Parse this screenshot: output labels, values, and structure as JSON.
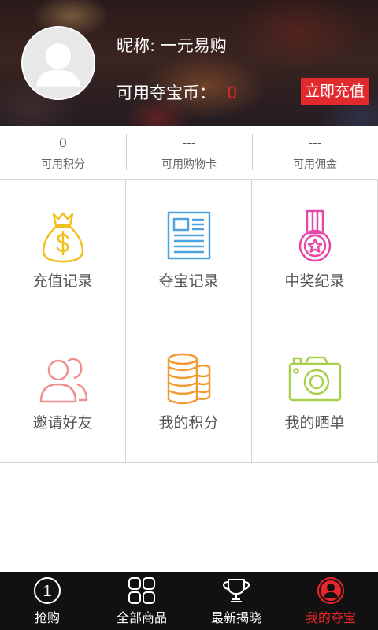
{
  "profile": {
    "nickname": "昵称: 一元易购",
    "coins_label": "可用夺宝币：",
    "coins_value": "0",
    "recharge_button": "立即充值"
  },
  "stats": [
    {
      "value": "0",
      "label": "可用积分"
    },
    {
      "value": "---",
      "label": "可用购物卡"
    },
    {
      "value": "---",
      "label": "可用佣金"
    }
  ],
  "menu": [
    {
      "label": "充值记录",
      "icon": "money-bag-icon",
      "color": "#f2c01e"
    },
    {
      "label": "夺宝记录",
      "icon": "newspaper-icon",
      "color": "#4fa3e0"
    },
    {
      "label": "中奖纪录",
      "icon": "medal-icon",
      "color": "#e548a6"
    },
    {
      "label": "邀请好友",
      "icon": "users-icon",
      "color": "#f08f90"
    },
    {
      "label": "我的积分",
      "icon": "coin-stack-icon",
      "color": "#f39a2e"
    },
    {
      "label": "我的晒单",
      "icon": "camera-icon",
      "color": "#a8cf4a"
    }
  ],
  "nav": [
    {
      "label": "抢购",
      "icon": "number-one-circle-icon",
      "glyph": "1"
    },
    {
      "label": "全部商品",
      "icon": "grid-icon"
    },
    {
      "label": "最新揭晓",
      "icon": "trophy-icon"
    },
    {
      "label": "我的夺宝",
      "icon": "user-circle-icon",
      "active": true,
      "active_color": "#e8262b"
    }
  ]
}
